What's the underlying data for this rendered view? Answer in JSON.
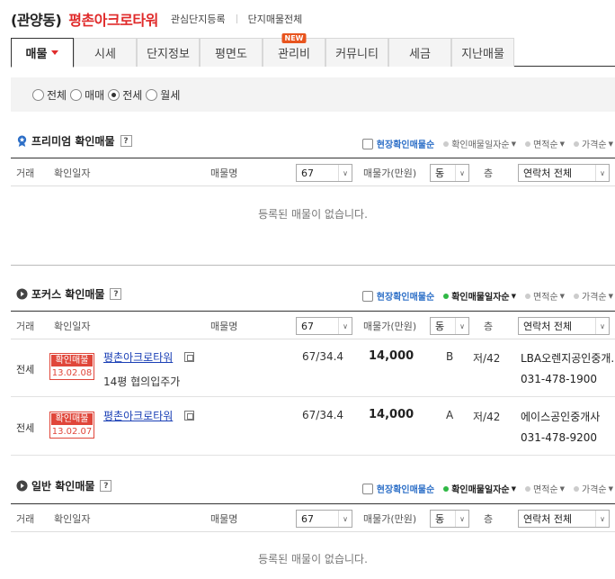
{
  "header": {
    "region": "(관양동)",
    "complex_name": "평촌아크로타워",
    "link_favorite": "관심단지등록",
    "link_all": "단지매물전체"
  },
  "tabs": [
    {
      "label": "매물",
      "active": true
    },
    {
      "label": "시세"
    },
    {
      "label": "단지정보"
    },
    {
      "label": "평면도"
    },
    {
      "label": "관리비",
      "badge": "NEW"
    },
    {
      "label": "커뮤니티"
    },
    {
      "label": "세금"
    },
    {
      "label": "지난매물"
    }
  ],
  "filter": {
    "options": [
      "전체",
      "매매",
      "전세",
      "월세"
    ],
    "selected": "전세"
  },
  "table_header": {
    "col_deal": "거래",
    "col_date": "확인일자",
    "col_name": "매물명",
    "area_select": "67",
    "col_price": "매물가(만원)",
    "dong_select": "동",
    "col_floor": "층",
    "contact_select": "연락처 전체"
  },
  "sort": {
    "site_confirm": "현장확인매물순",
    "by_date": "확인매물일자순",
    "by_area": "면적순",
    "by_price": "가격순"
  },
  "sections": {
    "premium": {
      "title": "프리미엄 확인매물",
      "empty": "등록된 매물이 없습니다."
    },
    "focus": {
      "title": "포커스 확인매물"
    },
    "general": {
      "title": "일반 확인매물",
      "empty": "등록된 매물이 없습니다."
    }
  },
  "listings": [
    {
      "deal": "전세",
      "stamp_label": "확인매물",
      "stamp_date": "13.02.08",
      "name": "평촌아크로타워",
      "desc": "14평 협의입주가",
      "area": "67/34.4",
      "price": "14,000",
      "dong": "B",
      "floor": "저/42",
      "agent": "LBA오렌지공인중개...",
      "phone": "031-478-1900"
    },
    {
      "deal": "전세",
      "stamp_label": "확인매물",
      "stamp_date": "13.02.07",
      "name": "평촌아크로타워",
      "desc": "",
      "area": "67/34.4",
      "price": "14,000",
      "dong": "A",
      "floor": "저/42",
      "agent": "에이스공인중개사",
      "phone": "031-478-9200"
    }
  ],
  "colors": {
    "accent_red": "#e02b2b",
    "link_blue": "#1a3fb5",
    "sort_blue": "#2d6fc7",
    "badge_orange": "#e8541e",
    "dot_green": "#2fb845"
  }
}
